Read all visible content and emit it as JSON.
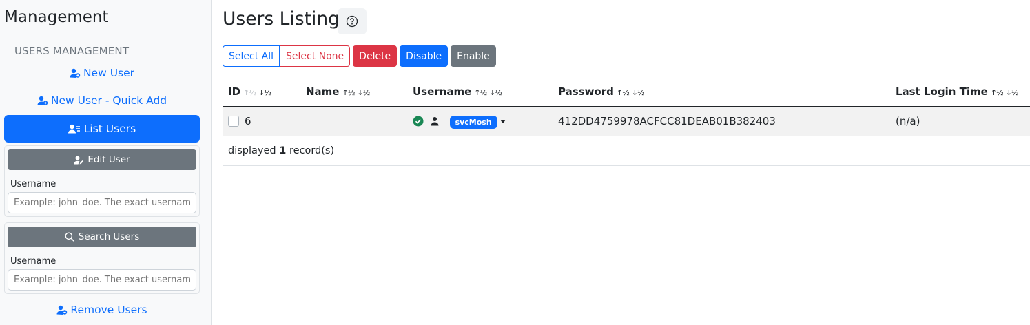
{
  "sidebar": {
    "title": "Management",
    "section": "USERS MANAGEMENT",
    "new_user": "New User",
    "new_user_quick": "New User - Quick Add",
    "list_users": "List Users",
    "edit_card": {
      "button": "Edit User",
      "label": "Username",
      "placeholder": "Example: john_doe. The exact username t"
    },
    "search_card": {
      "button": "Search Users",
      "label": "Username",
      "placeholder": "Example: john_doe. The exact username t"
    },
    "remove_users": "Remove Users"
  },
  "main": {
    "title": "Users Listing",
    "toolbar": {
      "select_all": "Select All",
      "select_none": "Select None",
      "delete": "Delete",
      "disable": "Disable",
      "enable": "Enable"
    },
    "columns": {
      "id": "ID",
      "name": "Name",
      "username": "Username",
      "password": "Password",
      "last_login": "Last Login Time"
    },
    "rows": [
      {
        "id": "6",
        "name": "",
        "username": "svcMosh",
        "password": "412DD4759978ACFCC81DEAB01B382403",
        "last_login": "(n/a)"
      }
    ],
    "footer": {
      "prefix": "displayed",
      "count": "1",
      "suffix": "record(s)"
    }
  },
  "colors": {
    "primary": "#0d6efd",
    "danger": "#dc3545",
    "secondary": "#6c757d",
    "success": "#198754"
  }
}
